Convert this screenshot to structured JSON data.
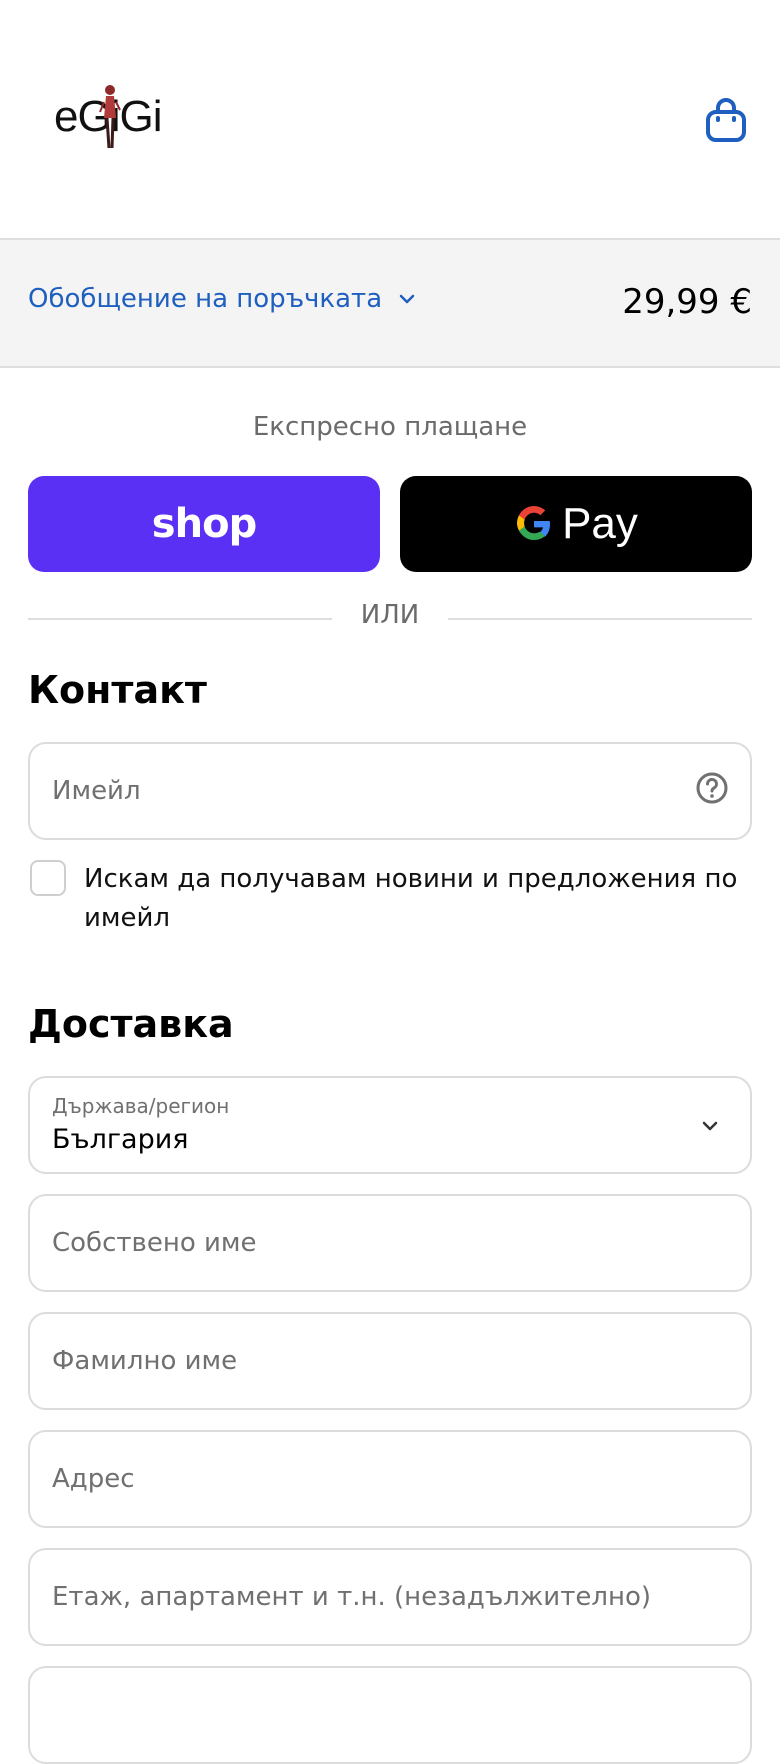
{
  "header": {
    "logo_text": "eGiGi",
    "cart_icon": "shopping-bag-icon",
    "accent": "#1f5fbf"
  },
  "summary": {
    "toggle_label": "Обобщение на поръчката",
    "total": "29,99 €"
  },
  "express": {
    "title": "Експресно плащане",
    "shop_label": "shop",
    "gpay_label": "Pay",
    "shop_color": "#5a31f4"
  },
  "divider": {
    "or_text": "ИЛИ"
  },
  "contact": {
    "title": "Контакт",
    "email_placeholder": "Имейл",
    "newsletter_label": "Искам да получавам новини и предложения по имейл"
  },
  "delivery": {
    "title": "Доставка",
    "country_label": "Държава/регион",
    "country_value": "България",
    "first_name_placeholder": "Собствено име",
    "last_name_placeholder": "Фамилно име",
    "address_placeholder": "Адрес",
    "apartment_placeholder": "Етаж, апартамент и т.н. (незадължително)"
  }
}
